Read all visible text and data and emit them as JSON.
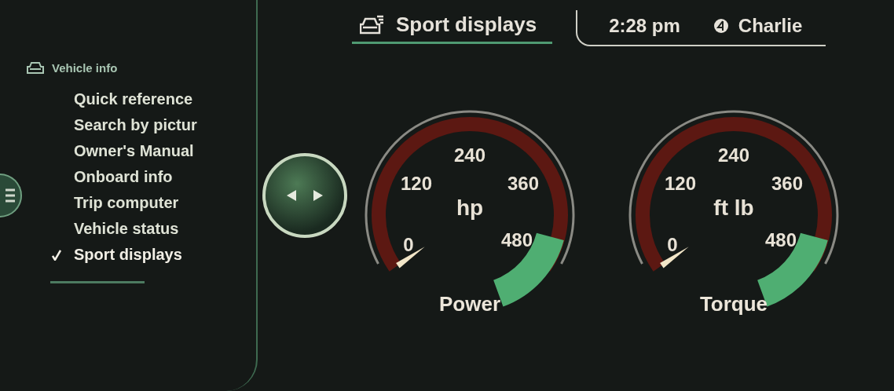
{
  "header": {
    "title": "Sport displays",
    "time": "2:28 pm",
    "user": "Charlie"
  },
  "menu": {
    "title": "Vehicle info",
    "items": [
      {
        "label": "Quick reference",
        "selected": false
      },
      {
        "label": "Search by pictur",
        "selected": false
      },
      {
        "label": "Owner's Manual",
        "selected": false
      },
      {
        "label": "Onboard info",
        "selected": false
      },
      {
        "label": "Trip computer",
        "selected": false
      },
      {
        "label": "Vehicle status",
        "selected": false
      },
      {
        "label": "Sport displays",
        "selected": true
      }
    ]
  },
  "gauges": [
    {
      "unit": "hp",
      "label": "Power",
      "ticks": [
        "0",
        "120",
        "240",
        "360",
        "480"
      ]
    },
    {
      "unit": "ft lb",
      "label": "Torque",
      "ticks": [
        "0",
        "120",
        "240",
        "360",
        "480"
      ]
    }
  ]
}
